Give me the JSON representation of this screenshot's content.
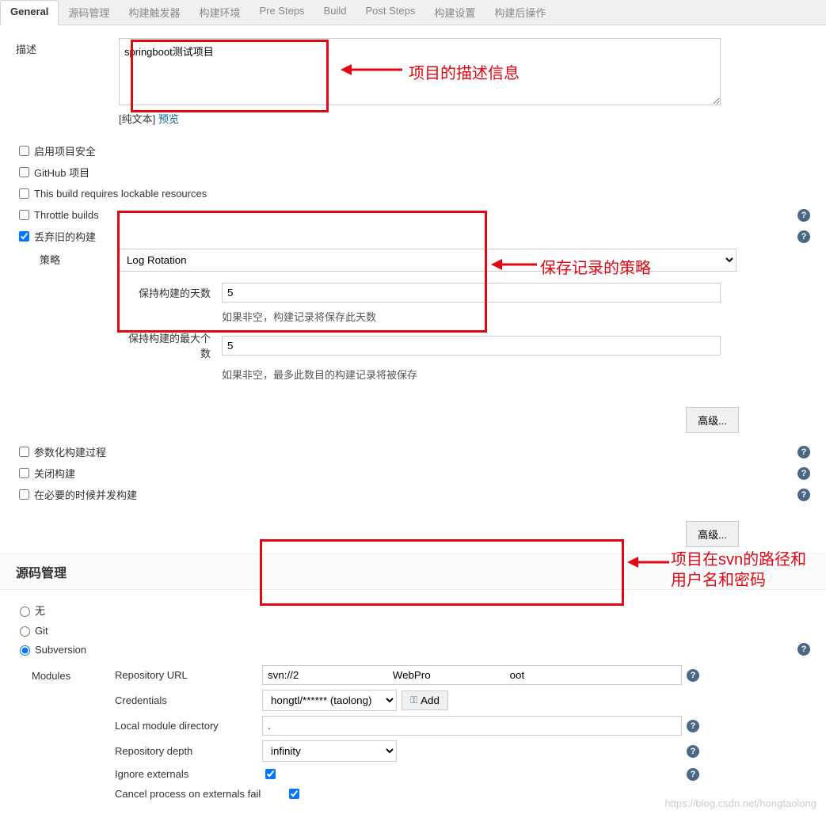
{
  "tabs": {
    "general": "General",
    "scm": "源码管理",
    "triggers": "构建触发器",
    "env": "构建环境",
    "pre": "Pre Steps",
    "build": "Build",
    "post": "Post Steps",
    "settings": "构建设置",
    "postbuild": "构建后操作"
  },
  "general": {
    "desc_label": "描述",
    "desc_value": "springboot测试项目",
    "plain_text_label": "[纯文本]",
    "preview_label": "预览"
  },
  "options": {
    "enable_security": "启用项目安全",
    "github_project": "GitHub 项目",
    "lockable": "This build requires lockable resources",
    "throttle": "Throttle builds",
    "discard_old": "丢弃旧的构建"
  },
  "strategy": {
    "label": "策略",
    "select_value": "Log Rotation",
    "days_label": "保持构建的天数",
    "days_value": "5",
    "days_hint": "如果非空，构建记录将保存此天数",
    "max_label": "保持构建的最大个数",
    "max_value": "5",
    "max_hint": "如果非空，最多此数目的构建记录将被保存"
  },
  "advanced_btn": "高级...",
  "options2": {
    "parameterized": "参数化构建过程",
    "disable": "关闭构建",
    "concurrent": "在必要的时候并发构建"
  },
  "scm": {
    "title": "源码管理",
    "none": "无",
    "git": "Git",
    "svn": "Subversion",
    "modules_label": "Modules",
    "repo_url_label": "Repository URL",
    "repo_url_value": "svn://2                                WebPro                           oot",
    "cred_label": "Credentials",
    "cred_value": "hongtl/****** (taolong)",
    "add_label": "Add",
    "local_dir_label": "Local module directory",
    "local_dir_value": ".",
    "depth_label": "Repository depth",
    "depth_value": "infinity",
    "ignore_ext_label": "Ignore externals",
    "cancel_ext_label": "Cancel process on externals fail"
  },
  "annotations": {
    "desc": "项目的描述信息",
    "strategy": "保存记录的策略",
    "svn": "项目在svn的路径和用户名和密码"
  },
  "help_glyph": "?",
  "watermark": "https://blog.csdn.net/hongtaolong"
}
